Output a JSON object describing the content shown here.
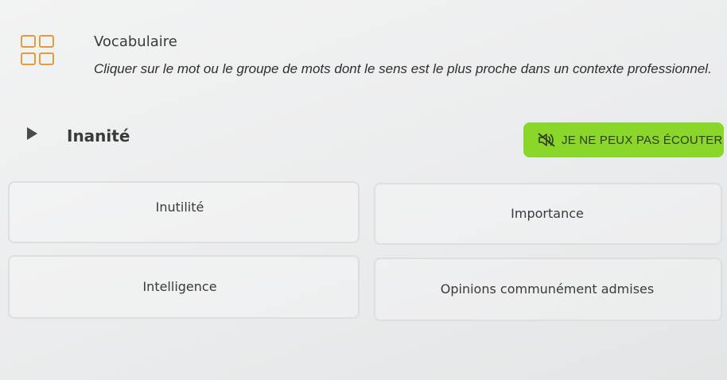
{
  "header": {
    "title": "Vocabulaire",
    "icon": "grid-four-squares-icon",
    "icon_color": "#e39b3c"
  },
  "instruction": "Cliquer sur le mot ou le groupe de mots dont le sens est le plus proche dans un contexte professionnel.",
  "prompt": {
    "play_icon": "play-icon",
    "word": "Inanité"
  },
  "cant_listen_button": {
    "icon": "speaker-muted-icon",
    "label": "JE NE PEUX PAS ÉCOUTER",
    "color": "#8bd62a"
  },
  "options": [
    {
      "label": "Inutilité"
    },
    {
      "label": "Importance"
    },
    {
      "label": "Intelligence"
    },
    {
      "label": "Opinions communément admises"
    }
  ]
}
